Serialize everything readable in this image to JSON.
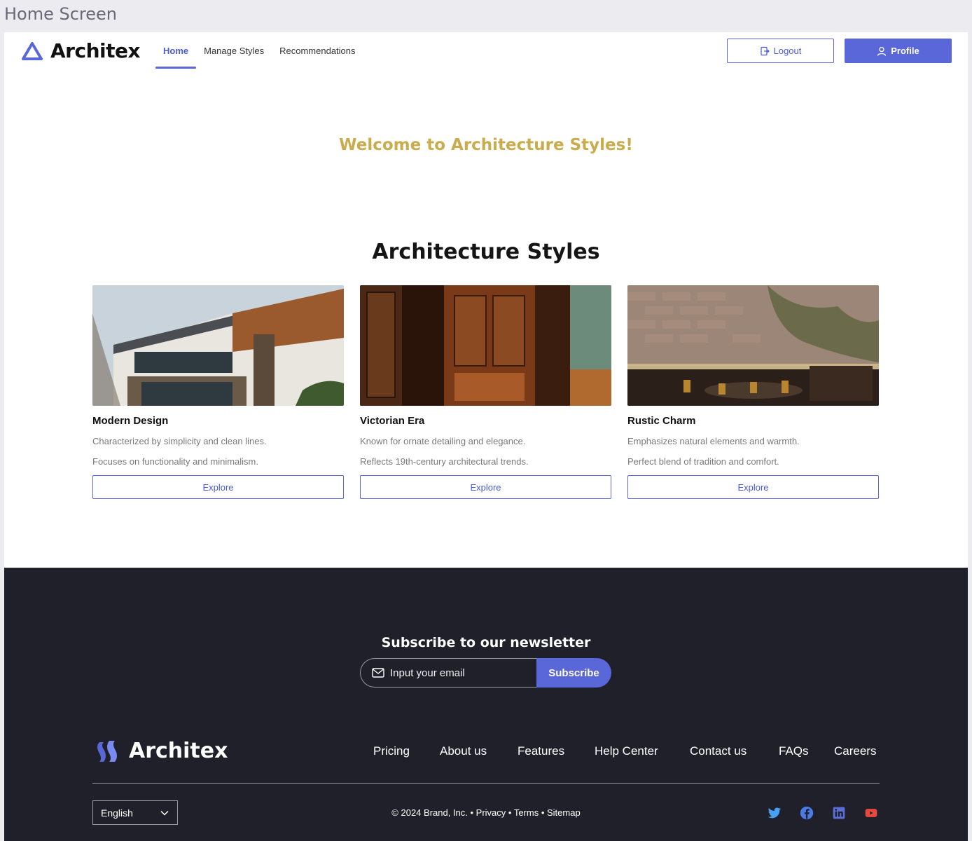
{
  "screen_label": "Home Screen",
  "header": {
    "brand": "Architex",
    "nav": [
      {
        "label": "Home",
        "active": true
      },
      {
        "label": "Manage Styles",
        "active": false
      },
      {
        "label": "Recommendations",
        "active": false
      }
    ],
    "logout_label": "Logout",
    "profile_label": "Profile"
  },
  "welcome": "Welcome to Architecture Styles!",
  "section_title": "Architecture Styles",
  "cards": [
    {
      "title": "Modern Design",
      "desc1": "Characterized by simplicity and clean lines.",
      "desc2": "Focuses on functionality and minimalism.",
      "button": "Explore"
    },
    {
      "title": "Victorian Era",
      "desc1": "Known for ornate detailing and elegance.",
      "desc2": "Reflects 19th-century architectural trends.",
      "button": "Explore"
    },
    {
      "title": "Rustic Charm",
      "desc1": "Emphasizes natural elements and warmth.",
      "desc2": "Perfect blend of tradition and comfort.",
      "button": "Explore"
    }
  ],
  "footer": {
    "newsletter_title": "Subscribe to our newsletter",
    "email_placeholder": "Input your email",
    "subscribe_label": "Subscribe",
    "brand": "Architex",
    "links": [
      "Pricing",
      "About us",
      "Features",
      "Help Center",
      "Contact us",
      "FAQs",
      "Careers"
    ],
    "language": "English",
    "copyright": "© 2024 Brand, Inc. • Privacy • Terms • Sitemap",
    "social": [
      "twitter-icon",
      "facebook-icon",
      "linkedin-icon",
      "youtube-icon"
    ]
  },
  "colors": {
    "accent": "#5a67d8",
    "welcome": "#c9ac4d",
    "footer_bg": "#1f2029"
  }
}
